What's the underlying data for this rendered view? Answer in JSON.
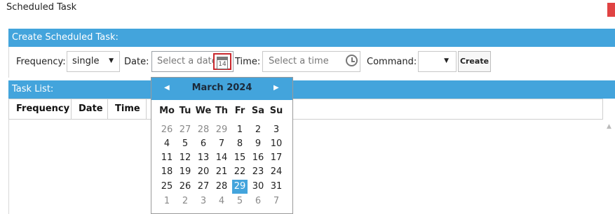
{
  "window": {
    "title": "Scheduled Task"
  },
  "create_section": {
    "title": "Create Scheduled Task:"
  },
  "form": {
    "frequency_label": "Frequency:",
    "frequency_value": "single",
    "date_label": "Date:",
    "date_placeholder": "Select a date",
    "calendar_icon_number": "14",
    "time_label": "Time:",
    "time_placeholder": "Select a time",
    "command_label": "Command:",
    "command_value": "",
    "create_label": "Create"
  },
  "task_list": {
    "title": "Task List:",
    "columns": [
      "Frequency",
      "Date",
      "Time"
    ]
  },
  "calendar": {
    "month_label": "March 2024",
    "weekdays": [
      "Mo",
      "Tu",
      "We",
      "Th",
      "Fr",
      "Sa",
      "Su"
    ],
    "weeks": [
      [
        "26",
        "27",
        "28",
        "29",
        "1",
        "2",
        "3"
      ],
      [
        "4",
        "5",
        "6",
        "7",
        "8",
        "9",
        "10"
      ],
      [
        "11",
        "12",
        "13",
        "14",
        "15",
        "16",
        "17"
      ],
      [
        "18",
        "19",
        "20",
        "21",
        "22",
        "23",
        "24"
      ],
      [
        "25",
        "26",
        "27",
        "28",
        "29",
        "30",
        "31"
      ],
      [
        "1",
        "2",
        "3",
        "4",
        "5",
        "6",
        "7"
      ]
    ],
    "selected_day": "29",
    "accent_color": "#43a4dc"
  },
  "icons": {
    "arrow_down": "▼",
    "prev": "◀",
    "next": "▶",
    "scroll_up": "▲"
  }
}
